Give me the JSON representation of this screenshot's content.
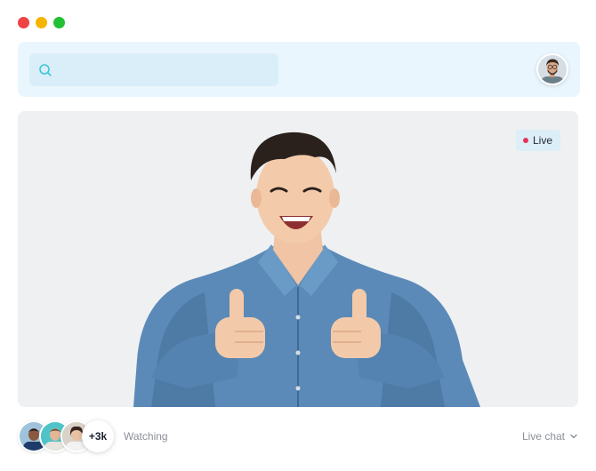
{
  "window": {
    "controls": [
      "close",
      "minimize",
      "maximize"
    ],
    "colors": {
      "close": "#ee4444",
      "minimize": "#f5b400",
      "maximize": "#22c033"
    }
  },
  "topbar": {
    "search": {
      "icon": "search-icon",
      "value": "",
      "placeholder": ""
    },
    "profile_avatar": "user-avatar"
  },
  "stream": {
    "status_label": "Live",
    "status_color": "#e8335a"
  },
  "footer": {
    "viewer_avatars": [
      "viewer-avatar-1",
      "viewer-avatar-2",
      "viewer-avatar-3"
    ],
    "viewer_count": "+3k",
    "watching_label": "Watching",
    "chat_label": "Live chat",
    "chat_icon": "chevron-down-icon"
  },
  "colors": {
    "accent": "#3ec6d4",
    "topbar_bg": "#eaf6fd",
    "search_bg": "#d9eef9",
    "video_bg": "#eff0f2"
  }
}
